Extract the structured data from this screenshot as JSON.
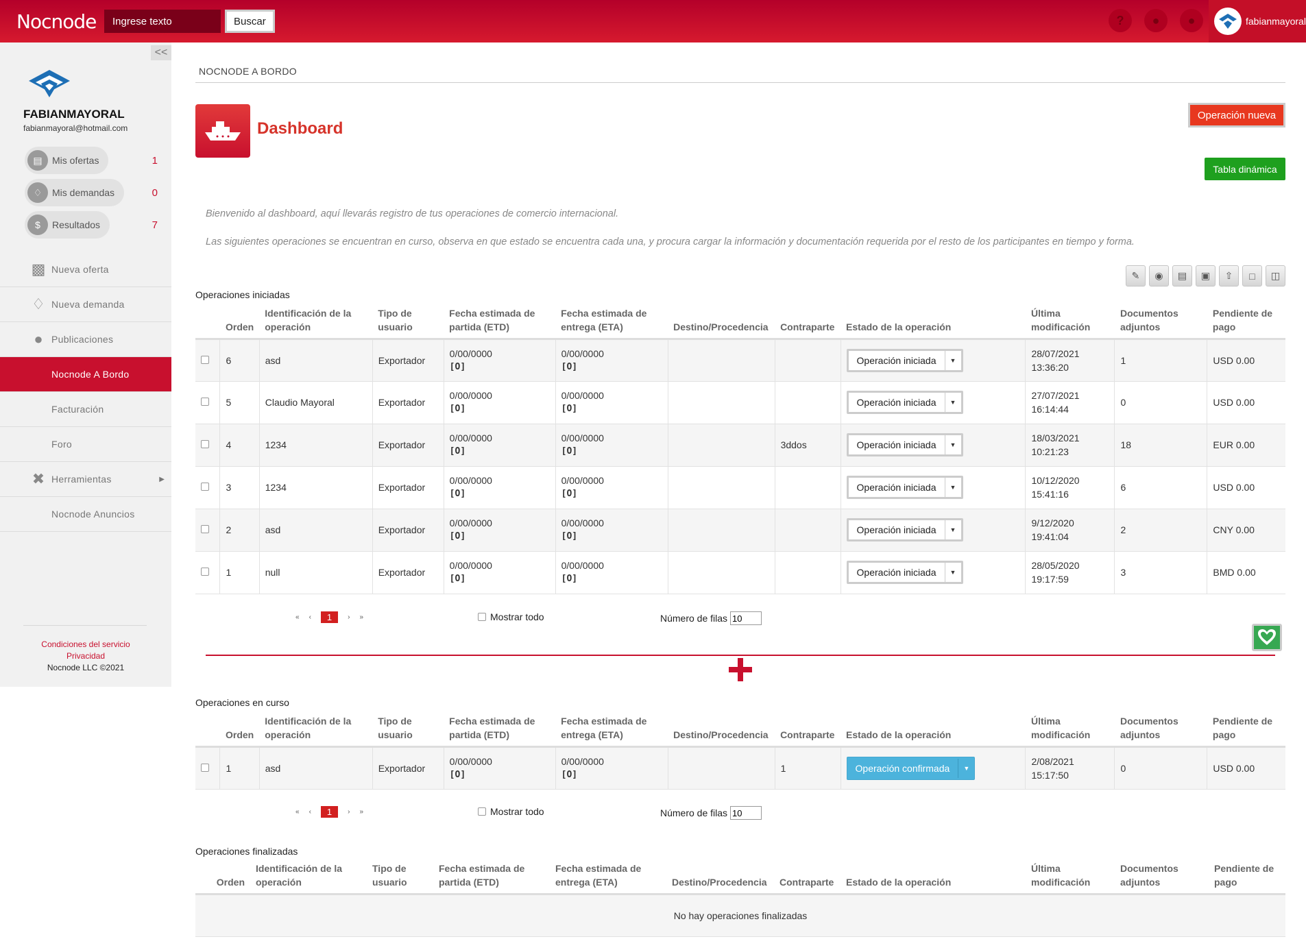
{
  "topbar": {
    "logo": "Nocnode",
    "search_placeholder": "Ingrese texto",
    "search_button": "Buscar",
    "user_name": "fabianmayoral",
    "icons": [
      "help-icon",
      "bell-icon",
      "chat-icon"
    ]
  },
  "sidebar": {
    "collapse": "<<",
    "profile_name": "FABIANMAYORAL",
    "profile_email": "fabianmayoral@hotmail.com",
    "stats": [
      {
        "label": "Mis ofertas",
        "count": "1"
      },
      {
        "label": "Mis demandas",
        "count": "0"
      },
      {
        "label": "Resultados",
        "count": "7"
      }
    ],
    "nav": [
      {
        "label": "Nueva oferta",
        "icon": "briefcase-icon"
      },
      {
        "label": "Nueva demanda",
        "icon": "cart-icon"
      },
      {
        "label": "Publicaciones",
        "icon": "globe-icon"
      },
      {
        "label": "Nocnode A Bordo",
        "icon": "",
        "active": true
      },
      {
        "label": "Facturación",
        "icon": ""
      },
      {
        "label": "Foro",
        "icon": ""
      },
      {
        "label": "Herramientas",
        "icon": "tools-icon"
      },
      {
        "label": "Nocnode Anuncios",
        "icon": ""
      }
    ],
    "footer": {
      "terms": "Condiciones del servicio",
      "privacy": "Privacidad",
      "copyright": "Nocnode LLC ©2021"
    }
  },
  "main": {
    "breadcrumb": "NOCNODE A BORDO",
    "title": "Dashboard",
    "new_op_button": "Operación nueva",
    "pivot_button": "Tabla dinámica",
    "intro_1": "Bienvenido al dashboard, aquí llevarás registro de tus operaciones de comercio internacional.",
    "intro_2": "Las siguientes operaciones se encuentran en curso, observa en que estado se encuentra cada una, y procura cargar la información y documentación requerida por el resto de los participantes en tiempo y forma.",
    "toolbar_icons": [
      "edit-icon",
      "eye-icon",
      "document-icon",
      "document-add-icon",
      "upload-icon",
      "unlock-icon",
      "trash-icon"
    ],
    "columns": {
      "orden": "Orden",
      "id_1": "Identificación de la",
      "id_2": "operación",
      "tipo_1": "Tipo de",
      "tipo_2": "usuario",
      "etd_1": "Fecha estimada de",
      "etd_2": "partida (ETD)",
      "eta_1": "Fecha estimada de",
      "eta_2": "entrega (ETA)",
      "destino": "Destino/Procedencia",
      "contraparte": "Contraparte",
      "estado": "Estado de la operación",
      "ultima_1": "Última",
      "ultima_2": "modificación",
      "docs_1": "Documentos",
      "docs_2": "adjuntos",
      "pend_1": "Pendiente de",
      "pend_2": "pago"
    },
    "iniciadas": {
      "title": "Operaciones iniciadas",
      "rows": [
        {
          "orden": "6",
          "id": "asd",
          "tipo": "Exportador",
          "etd": "0/00/0000",
          "etd_code": "[O]",
          "eta": "0/00/0000",
          "eta_code": "[O]",
          "destino": "",
          "contraparte": "",
          "estado": "Operación iniciada",
          "fecha": "28/07/2021",
          "hora": "13:36:20",
          "docs": "1",
          "pendiente": "USD 0.00"
        },
        {
          "orden": "5",
          "id": "Claudio Mayoral",
          "tipo": "Exportador",
          "etd": "0/00/0000",
          "etd_code": "[O]",
          "eta": "0/00/0000",
          "eta_code": "[O]",
          "destino": "",
          "contraparte": "",
          "estado": "Operación iniciada",
          "fecha": "27/07/2021",
          "hora": "16:14:44",
          "docs": "0",
          "pendiente": "USD 0.00"
        },
        {
          "orden": "4",
          "id": "1234",
          "tipo": "Exportador",
          "etd": "0/00/0000",
          "etd_code": "[O]",
          "eta": "0/00/0000",
          "eta_code": "[O]",
          "destino": "",
          "contraparte": "3ddos",
          "estado": "Operación iniciada",
          "fecha": "18/03/2021",
          "hora": "10:21:23",
          "docs": "18",
          "pendiente": "EUR 0.00"
        },
        {
          "orden": "3",
          "id": "1234",
          "tipo": "Exportador",
          "etd": "0/00/0000",
          "etd_code": "[O]",
          "eta": "0/00/0000",
          "eta_code": "[O]",
          "destino": "",
          "contraparte": "",
          "estado": "Operación iniciada",
          "fecha": "10/12/2020",
          "hora": "15:41:16",
          "docs": "6",
          "pendiente": "USD 0.00"
        },
        {
          "orden": "2",
          "id": "asd",
          "tipo": "Exportador",
          "etd": "0/00/0000",
          "etd_code": "[O]",
          "eta": "0/00/0000",
          "eta_code": "[O]",
          "destino": "",
          "contraparte": "",
          "estado": "Operación iniciada",
          "fecha": "9/12/2020",
          "hora": "19:41:04",
          "docs": "2",
          "pendiente": "CNY 0.00"
        },
        {
          "orden": "1",
          "id": "null",
          "tipo": "Exportador",
          "etd": "0/00/0000",
          "etd_code": "[O]",
          "eta": "0/00/0000",
          "eta_code": "[O]",
          "destino": "",
          "contraparte": "",
          "estado": "Operación iniciada",
          "fecha": "28/05/2020",
          "hora": "19:17:59",
          "docs": "3",
          "pendiente": "BMD 0.00"
        }
      ]
    },
    "en_curso": {
      "title": "Operaciones en curso",
      "rows": [
        {
          "orden": "1",
          "id": "asd",
          "tipo": "Exportador",
          "etd": "0/00/0000",
          "etd_code": "[O]",
          "eta": "0/00/0000",
          "eta_code": "[O]",
          "destino": "",
          "contraparte": "1",
          "estado": "Operación confirmada",
          "fecha": "2/08/2021",
          "hora": "15:17:50",
          "docs": "0",
          "pendiente": "USD 0.00"
        }
      ]
    },
    "finalizadas": {
      "title": "Operaciones finalizadas",
      "empty": "No hay operaciones finalizadas"
    },
    "pager": {
      "first": "«",
      "prev": "‹",
      "current": "1",
      "next": "›",
      "last": "»",
      "show_all": "Mostrar todo",
      "rows_label": "Número de filas",
      "rows_value": "10"
    }
  }
}
